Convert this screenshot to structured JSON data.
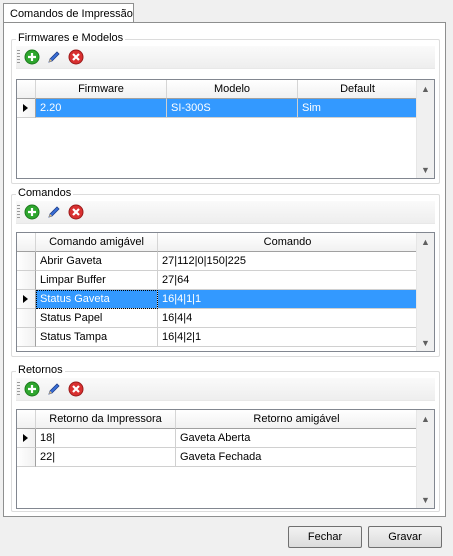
{
  "tab": {
    "label": "Comandos de Impressão"
  },
  "firmwares": {
    "title": "Firmwares e Modelos",
    "columns": [
      "Firmware",
      "Modelo",
      "Default"
    ],
    "rows": [
      {
        "firmware": "2.20",
        "modelo": "SI-300S",
        "default": "Sim"
      }
    ]
  },
  "comandos": {
    "title": "Comandos",
    "columns": [
      "Comando amigável",
      "Comando"
    ],
    "rows": [
      {
        "nome": "Abrir Gaveta",
        "comando": "27|112|0|150|225"
      },
      {
        "nome": "Limpar Buffer",
        "comando": "27|64"
      },
      {
        "nome": "Status Gaveta",
        "comando": "16|4|1|1"
      },
      {
        "nome": "Status Papel",
        "comando": "16|4|4"
      },
      {
        "nome": "Status Tampa",
        "comando": "16|4|2|1"
      }
    ]
  },
  "retornos": {
    "title": "Retornos",
    "columns": [
      "Retorno da Impressora",
      "Retorno amigável"
    ],
    "rows": [
      {
        "retorno": "18|",
        "amigavel": "Gaveta Aberta"
      },
      {
        "retorno": "22|",
        "amigavel": "Gaveta Fechada"
      }
    ]
  },
  "buttons": {
    "fechar": "Fechar",
    "gravar": "Gravar"
  },
  "icons": {
    "add": "add-icon",
    "edit": "edit-icon",
    "delete": "delete-icon"
  },
  "colors": {
    "selection": "#3399ff",
    "add": "#2ea62e",
    "delete": "#d93030"
  }
}
